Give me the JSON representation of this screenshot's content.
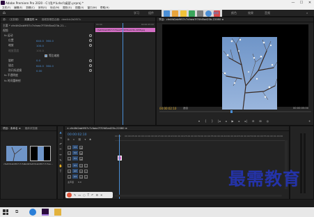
{
  "window": {
    "title": "Adobe Premiere Pro 2020 - C:\\用户\\Ldscl\\桌面\\.prproj *",
    "controls": [
      "—",
      "☐",
      "✕"
    ]
  },
  "menu": [
    "文件(F)",
    "编辑(E)",
    "剪辑(C)",
    "序列(S)",
    "标记(M)",
    "图形(G)",
    "视图(V)",
    "窗口(W)",
    "帮助(H)"
  ],
  "workspaces": [
    {
      "label": "学习",
      "active": false
    },
    {
      "label": "组件",
      "active": false
    },
    {
      "label": "编辑",
      "active": true
    },
    {
      "label": "颜色",
      "active": false
    },
    {
      "label": "效果",
      "active": false
    },
    {
      "label": "音频",
      "active": false
    }
  ],
  "tray_colors": [
    "#4b8fd6",
    "#e8a33a",
    "#f0c23a",
    "#3aa55b",
    "#7b7b7b",
    "#4b8fd6",
    "#d94a4a"
  ],
  "effect_controls": {
    "tabs": [
      "源：（无剪辑）",
      "效果控件 ≡",
      "音频剪辑混合器：dee4dc2b0f07c"
    ],
    "master": "主要 * cfe4fd2ab9f07c7cfaea7f70fd5ad23b-21...",
    "clip": "cfe4fd2ab9f07c7cfaea7f70fd5ad23b-2...",
    "section_video": "视频",
    "motion": "fx  运动",
    "position": {
      "label": "位置",
      "x": "640.0",
      "y": "360.0"
    },
    "scale": {
      "label": "缩放",
      "value": "100.0"
    },
    "scale_width": {
      "label": "缩放宽度",
      "value": "100.0"
    },
    "uniform": "等比缩放",
    "rotation": {
      "label": "旋转",
      "value": "0.0"
    },
    "anchor": {
      "label": "锚点",
      "x": "640.0",
      "y": "360.0"
    },
    "flicker": {
      "label": "防闪烁滤镜",
      "value": "0.00"
    },
    "opacity": "fx  不透明度",
    "timeremap": "fx  时间重映射"
  },
  "ec_timeline": {
    "time_start": "00:00",
    "time_end": "00:00:05:00",
    "clip": "cfe4fd2ab9f07c7cfaea7f70fd5ad23b-2208.jpg"
  },
  "program": {
    "title": "节目：cfe4fd2ab9f07c7cfaea7f70fd5ad23b-22080 ≡",
    "timecode": "00:00:02:10",
    "fit": "适合",
    "quality": "完整",
    "duration": "00:00:05:00"
  },
  "project": {
    "tabs": [
      "项目：未命名 ≡",
      "媒体浏览器"
    ],
    "items": [
      {
        "name": "cfe4fd2ab9f07c7cfae...",
        "dur": "5;00"
      },
      {
        "name": "cfe4fd2ab9f07c7cfae...",
        "dur": "5;00"
      }
    ]
  },
  "timeline": {
    "tab": "× cfe4fd2ab9f07c7cfaea7f70fd5ad23b-22080 ≡",
    "timecode": "00:00:02:10",
    "ruler": [
      "00:00",
      "00:00:05:00",
      "00:00:10:00",
      "00:00:15:00",
      "00:00:20:00",
      "00:00:25:00",
      "00:00:30:00",
      "00:00:35:00",
      "00:00:40:00",
      "00:00:45:00",
      "00:00:50:00",
      "00:00:55:00",
      "00:01:00:00"
    ],
    "tracks": [
      "V3",
      "V2",
      "V1",
      "A1",
      "A2",
      "A3"
    ],
    "master": "主声道",
    "master_val": "0.0"
  },
  "watermark": "最需教育"
}
